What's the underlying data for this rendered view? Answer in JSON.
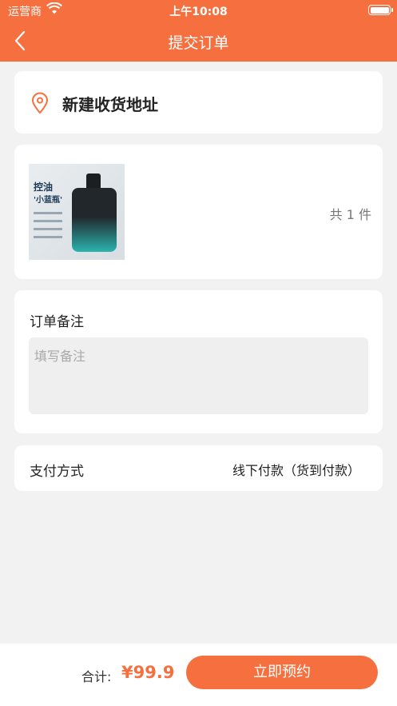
{
  "status_bar": {
    "carrier": "运营商",
    "time": "上午10:08",
    "wifi_icon": "wifi-icon",
    "battery_icon": "battery-icon"
  },
  "nav": {
    "title": "提交订单",
    "back_icon": "chevron-left-icon"
  },
  "address": {
    "icon": "location-pin-icon",
    "label": "新建收货地址"
  },
  "goods": {
    "image_text_1": "控油",
    "image_text_2": "'小蓝瓶'",
    "quantity": "共 1 件"
  },
  "remark": {
    "label": "订单备注",
    "placeholder": "填写备注",
    "value": ""
  },
  "payment": {
    "label": "支付方式",
    "value": "线下付款（货到付款）"
  },
  "footer": {
    "total_label": "合计:",
    "total_amount": "¥99.9",
    "submit_label": "立即预约"
  },
  "colors": {
    "accent": "#f5703e",
    "background": "#f2f2f2",
    "card": "#ffffff",
    "input_bg": "#efefef"
  }
}
